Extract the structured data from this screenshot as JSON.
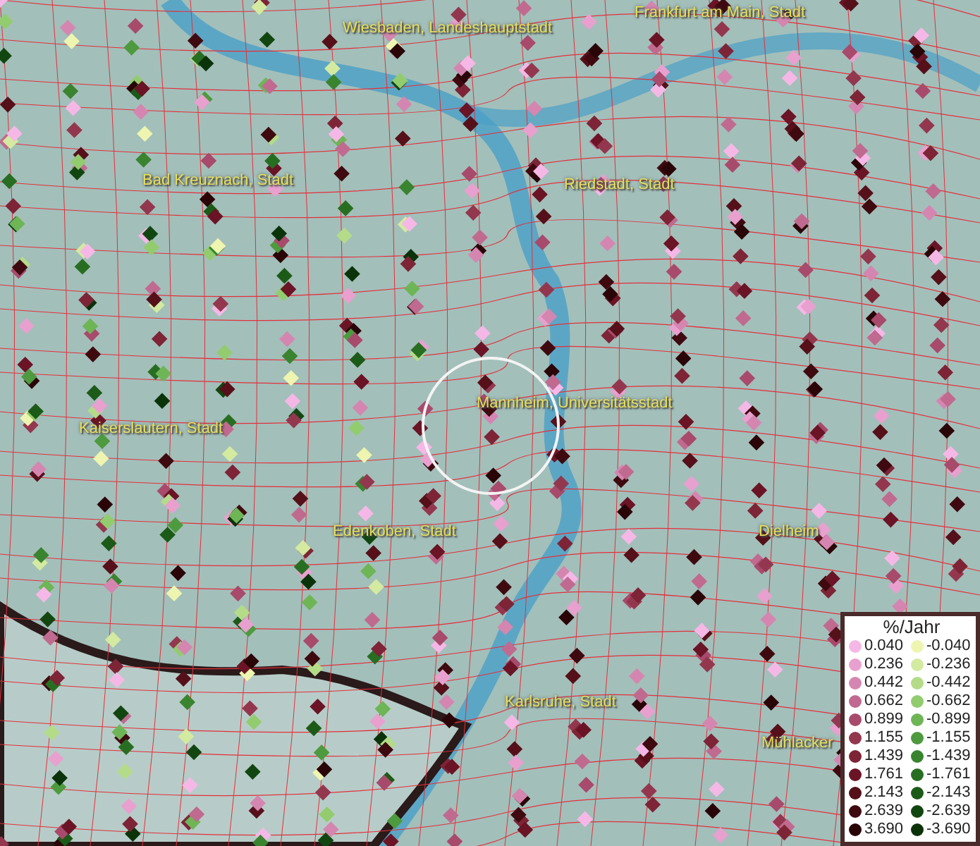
{
  "map": {
    "places": [
      {
        "name": "Wiesbaden, Landeshauptstadt"
      },
      {
        "name": "Frankfurt am Main, Stadt"
      },
      {
        "name": "Bad Kreuznach, Stadt"
      },
      {
        "name": "Riedstadt, Stadt"
      },
      {
        "name": "Kaiserslautern, Stadt"
      },
      {
        "name": "Mannheim, Universitätsstadt"
      },
      {
        "name": "Edenkoben, Stadt"
      },
      {
        "name": "Dielheim"
      },
      {
        "name": "Karlsruhe, Stadt"
      },
      {
        "name": "Mühlacker"
      }
    ]
  },
  "legend": {
    "title": "%/Jahr",
    "rows": [
      {
        "positive": {
          "value": "0.040",
          "color": "#f5b8e6"
        },
        "negative": {
          "value": "-0.040",
          "color": "#eef5b0"
        }
      },
      {
        "positive": {
          "value": "0.236",
          "color": "#e8a0cf"
        },
        "negative": {
          "value": "-0.236",
          "color": "#d3eaa0"
        }
      },
      {
        "positive": {
          "value": "0.442",
          "color": "#d486b0"
        },
        "negative": {
          "value": "-0.442",
          "color": "#b4dc88"
        }
      },
      {
        "positive": {
          "value": "0.662",
          "color": "#c06a90"
        },
        "negative": {
          "value": "-0.662",
          "color": "#92cc6e"
        }
      },
      {
        "positive": {
          "value": "0.899",
          "color": "#a84a6c"
        },
        "negative": {
          "value": "-0.899",
          "color": "#6eb556"
        }
      },
      {
        "positive": {
          "value": "1.155",
          "color": "#93374f"
        },
        "negative": {
          "value": "-1.155",
          "color": "#4e9a3e"
        }
      },
      {
        "positive": {
          "value": "1.439",
          "color": "#7d2436"
        },
        "negative": {
          "value": "-1.439",
          "color": "#3a8430"
        }
      },
      {
        "positive": {
          "value": "1.761",
          "color": "#6a1426"
        },
        "negative": {
          "value": "-1.761",
          "color": "#286e22"
        }
      },
      {
        "positive": {
          "value": "2.143",
          "color": "#55101a"
        },
        "negative": {
          "value": "-2.143",
          "color": "#1c5a18"
        }
      },
      {
        "positive": {
          "value": "2.639",
          "color": "#3e0a10"
        },
        "negative": {
          "value": "-2.639",
          "color": "#124610"
        }
      },
      {
        "positive": {
          "value": "3.690",
          "color": "#2a0508"
        },
        "negative": {
          "value": "-3.690",
          "color": "#0b330a"
        }
      }
    ]
  }
}
